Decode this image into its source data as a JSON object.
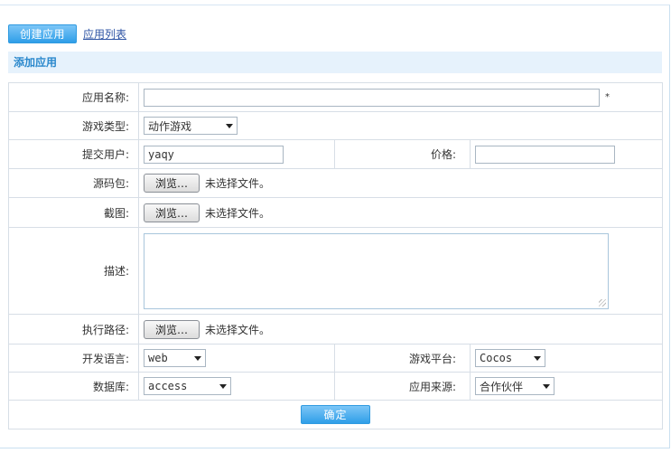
{
  "tabs": {
    "create": "创建应用",
    "list": "应用列表"
  },
  "section_title": "添加应用",
  "form": {
    "app_name": {
      "label": "应用名称:",
      "value": "",
      "required": "*"
    },
    "game_type": {
      "label": "游戏类型:",
      "value": "动作游戏"
    },
    "submitter": {
      "label": "提交用户:",
      "value": "yaqy"
    },
    "price": {
      "label": "价格:",
      "value": ""
    },
    "source_pkg": {
      "label": "源码包:",
      "button": "浏览…",
      "status": "未选择文件。"
    },
    "screenshot": {
      "label": "截图:",
      "button": "浏览…",
      "status": "未选择文件。"
    },
    "description": {
      "label": "描述:",
      "value": ""
    },
    "exec_path": {
      "label": "执行路径:",
      "button": "浏览…",
      "status": "未选择文件。"
    },
    "dev_lang": {
      "label": "开发语言:",
      "value": "web"
    },
    "platform": {
      "label": "游戏平台:",
      "value": "Cocos"
    },
    "database": {
      "label": "数据库:",
      "value": "access"
    },
    "app_source": {
      "label": "应用来源:",
      "value": "合作伙伴"
    }
  },
  "submit_label": "确定",
  "colors": {
    "accent": "#2f9ee8",
    "section_bg": "#e6f2fc",
    "section_text": "#2a88cc",
    "border": "#d7dee6"
  }
}
